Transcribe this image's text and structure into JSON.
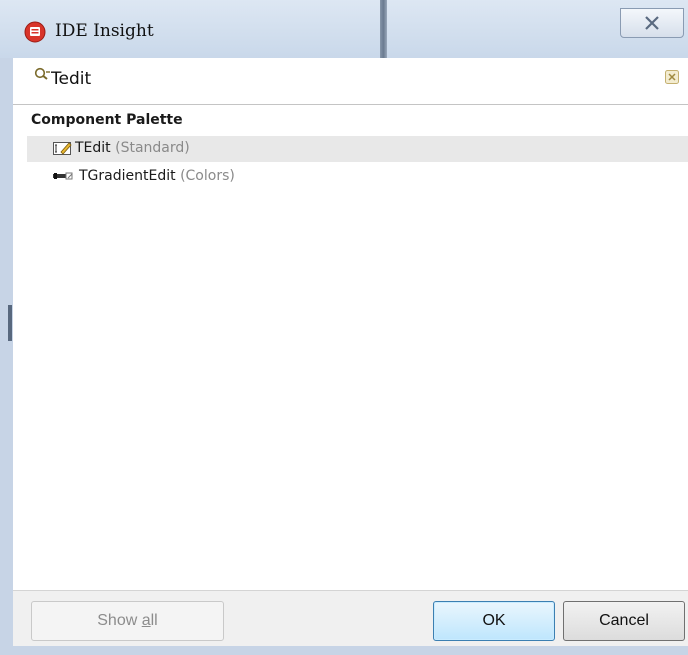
{
  "window": {
    "title": "IDE Insight",
    "close_icon": "close-x-icon",
    "app_icon": "ide-insight-icon"
  },
  "search": {
    "value": "Tedit",
    "search_icon": "search-icon",
    "clear_icon": "clear-icon"
  },
  "results": {
    "group_header": "Component Palette",
    "items": [
      {
        "name": "TEdit",
        "category": "(Standard)",
        "icon": "tedit-component-icon",
        "selected": true
      },
      {
        "name": "TGradientEdit",
        "category": "(Colors)",
        "icon": "tgradientedit-component-icon",
        "selected": false
      }
    ]
  },
  "footer": {
    "show_all_prefix": "Show ",
    "show_all_underlined": "a",
    "show_all_suffix": "ll",
    "ok_label": "OK",
    "cancel_label": "Cancel"
  },
  "colors": {
    "titlebar": "#c9d8ea",
    "selection": "#e8e8e8",
    "ok_border": "#3c7fb1"
  }
}
